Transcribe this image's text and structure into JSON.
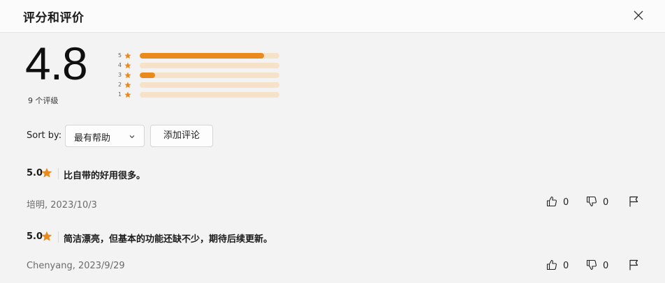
{
  "dialog": {
    "title": "评分和评价",
    "close_icon": "close-icon"
  },
  "summary": {
    "average": "4.8",
    "count_text": "9 个评级",
    "accent_color": "#ea8a1c",
    "track_color": "#f6e2c8",
    "histogram": [
      {
        "stars": "5",
        "fraction": 0.89
      },
      {
        "stars": "4",
        "fraction": 0
      },
      {
        "stars": "3",
        "fraction": 0.11
      },
      {
        "stars": "2",
        "fraction": 0
      },
      {
        "stars": "1",
        "fraction": 0
      }
    ]
  },
  "controls": {
    "sort_label": "Sort by:",
    "sort_value": "最有帮助",
    "add_review_label": "添加评论"
  },
  "reviews": [
    {
      "score": "5.0",
      "text": "比自带的好用很多。",
      "meta": "培明, 2023/10/3",
      "likes": "0",
      "dislikes": "0"
    },
    {
      "score": "5.0",
      "text": "简洁漂亮，但基本的功能还缺不少，期待后续更新。",
      "meta": "Chenyang, 2023/9/29",
      "likes": "0",
      "dislikes": "0"
    }
  ]
}
